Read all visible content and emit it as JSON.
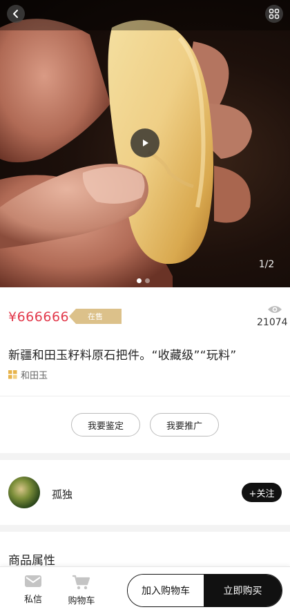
{
  "media": {
    "page_indicator": "1/2",
    "slide_count": 2,
    "active_slide": 1,
    "has_video": true
  },
  "product": {
    "price": "¥666666",
    "status": "在售",
    "view_count": "21074",
    "title": "新疆和田玉籽料原石把件。“收藏级”“玩料”",
    "category": "和田玉"
  },
  "actions": {
    "appraise": "我要鉴定",
    "promote": "我要推广"
  },
  "seller": {
    "name": "孤独",
    "follow_label": "+关注"
  },
  "sections": {
    "attributes_title": "商品属性"
  },
  "bottom_bar": {
    "message_label": "私信",
    "cart_label": "购物车",
    "add_to_cart": "加入购物车",
    "buy_now": "立即购买"
  },
  "icons": [
    "back-arrow-icon",
    "grid-menu-icon",
    "play-icon",
    "eye-icon",
    "category-icon",
    "message-icon",
    "cart-icon"
  ],
  "colors": {
    "price": "#e23a4c",
    "status_tag": "#dcc18a",
    "primary_dark": "#111111"
  }
}
